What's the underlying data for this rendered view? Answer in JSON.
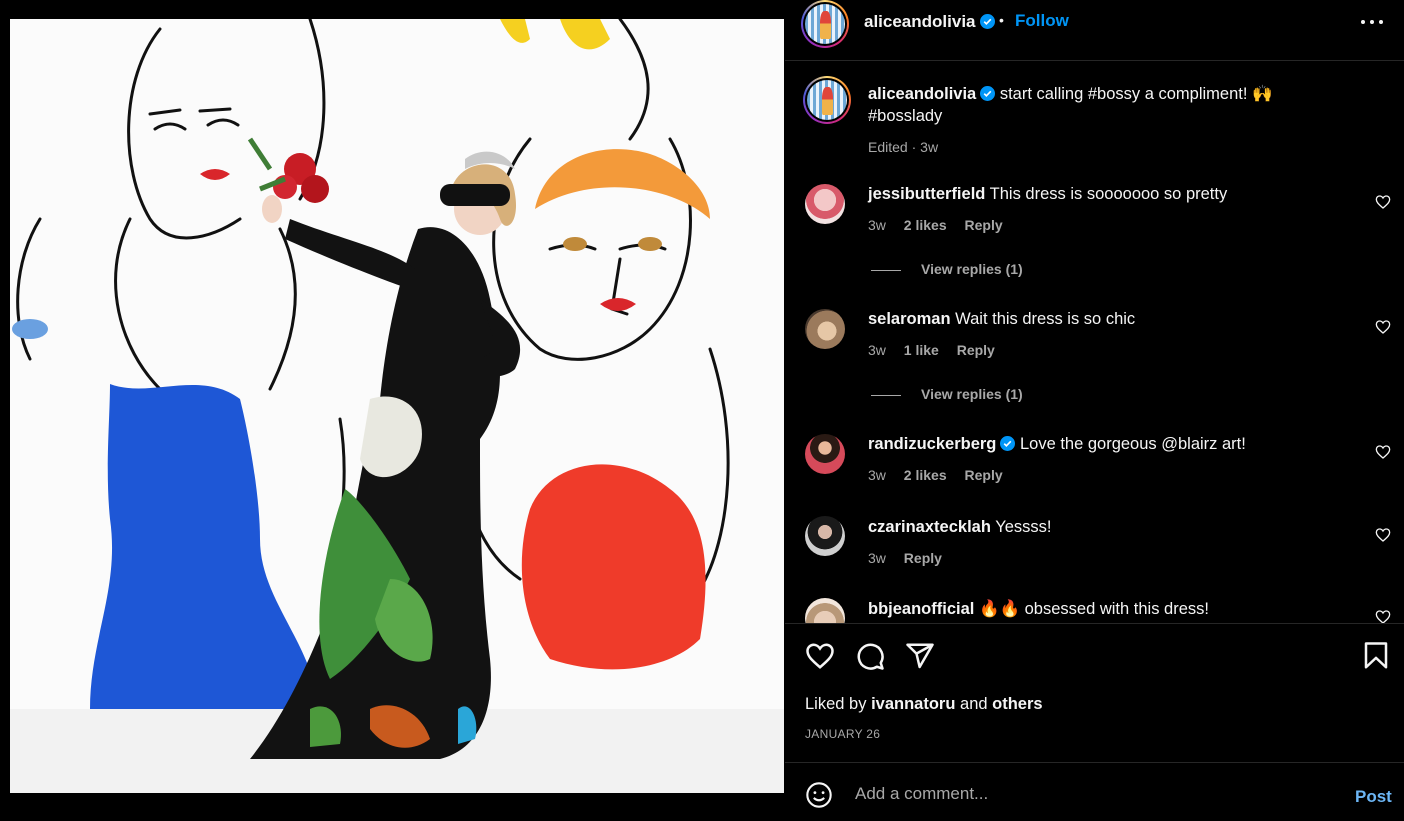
{
  "post": {
    "image_alt": "",
    "header": {
      "username": "aliceandolivia",
      "separator": "•",
      "follow_label": "Follow"
    },
    "caption": {
      "username": "aliceandolivia",
      "text": "start calling #bossy a compliment! 🙌 #bosslady",
      "edited": "Edited",
      "dot": "·",
      "time": "3w"
    },
    "comments": [
      {
        "username": "jessibutterfield",
        "verified": false,
        "text": "This dress is sooooooo so pretty",
        "time": "3w",
        "likes": "2 likes",
        "reply_label": "Reply",
        "view_replies": "View replies (1)"
      },
      {
        "username": "selaroman",
        "verified": false,
        "text": "Wait this dress is so chic",
        "time": "3w",
        "likes": "1 like",
        "reply_label": "Reply",
        "view_replies": "View replies (1)"
      },
      {
        "username": "randizuckerberg",
        "verified": true,
        "text": "Love the gorgeous @blairz art!",
        "time": "3w",
        "likes": "2 likes",
        "reply_label": "Reply"
      },
      {
        "username": "czarinaxtecklah",
        "verified": false,
        "text": "Yessss!",
        "time": "3w",
        "reply_label": "Reply"
      },
      {
        "username": "bbjeanofficial",
        "verified": false,
        "text": "🔥🔥 obsessed with this dress!"
      }
    ],
    "actions": {
      "icons": [
        "heart-icon",
        "comment-icon",
        "share-icon",
        "bookmark-icon"
      ]
    },
    "likes": {
      "prefix": "Liked by",
      "user": "ivannatoru",
      "and": "and",
      "others": "others"
    },
    "date": "JANUARY 26",
    "composer": {
      "placeholder": "Add a comment...",
      "post_label": "Post"
    }
  },
  "colors": {
    "background": "#000000",
    "text": "#f5f5f5",
    "secondary_text": "#a8a8a8",
    "link_blue": "#0095f6",
    "verified_blue": "#0095f6",
    "divider": "#262626"
  }
}
